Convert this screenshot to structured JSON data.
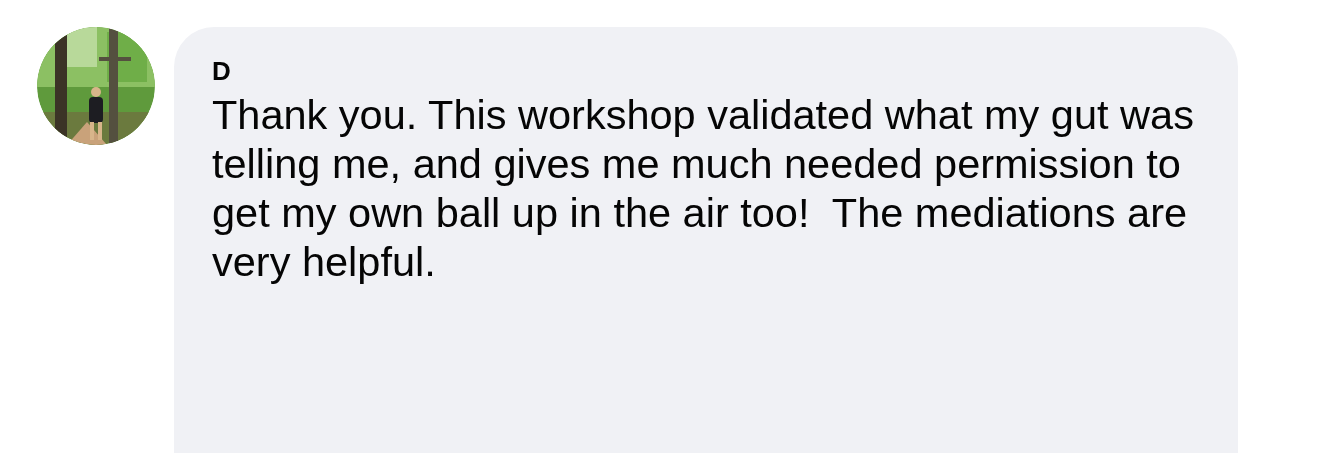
{
  "comment": {
    "author": "D",
    "text": "Thank you. This workshop validated what my gut was telling me, and gives me much needed permission to get my own ball up in the air too!  The mediations are very helpful."
  }
}
